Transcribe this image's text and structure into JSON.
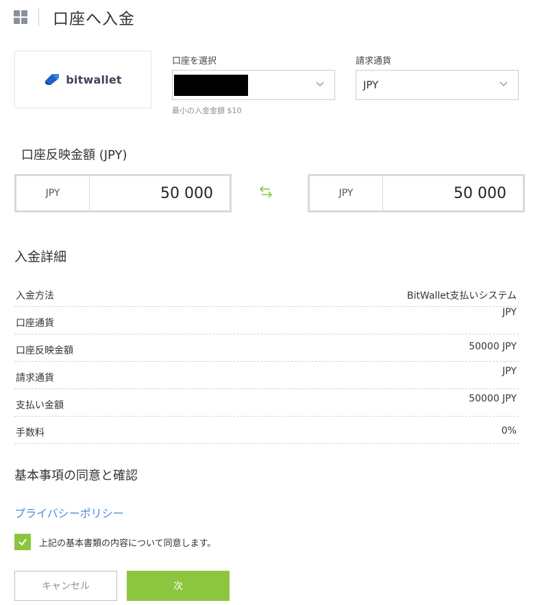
{
  "header": {
    "title": "口座へ入金",
    "menu_icon": "grid-icon"
  },
  "payment": {
    "logo_text": "bitwallet",
    "logo_icon": "bitwallet-logo-icon"
  },
  "account_select": {
    "label": "口座を選択",
    "value": "",
    "hint": "最小の入金金額 $10"
  },
  "billing_currency": {
    "label": "請求通貨",
    "value": "JPY"
  },
  "conversion": {
    "title": "口座反映金額 (JPY)",
    "from": {
      "currency": "JPY",
      "amount": "50 000"
    },
    "to": {
      "currency": "JPY",
      "amount": "50 000"
    },
    "swap_icon": "swap-arrows-icon"
  },
  "details": {
    "title": "入金詳細",
    "rows": [
      {
        "label": "入金方法",
        "value": "BitWallet支払いシステム"
      },
      {
        "label": "口座通貨",
        "value": "JPY"
      },
      {
        "label": "口座反映金額",
        "value": "50000 JPY"
      },
      {
        "label": "請求通貨",
        "value": "JPY"
      },
      {
        "label": "支払い金額",
        "value": "50000 JPY"
      },
      {
        "label": "手数料",
        "value": "0%"
      }
    ]
  },
  "agreement": {
    "title": "基本事項の同意と確認",
    "privacy_link": "プライバシーポリシー",
    "checkbox_label": "上記の基本書類の内容について同意します。",
    "checked": true
  },
  "buttons": {
    "cancel": "キャンセル",
    "next": "次"
  },
  "colors": {
    "accent": "#8cc63f",
    "link": "#4a8fd9",
    "border": "#c9ccd1"
  }
}
